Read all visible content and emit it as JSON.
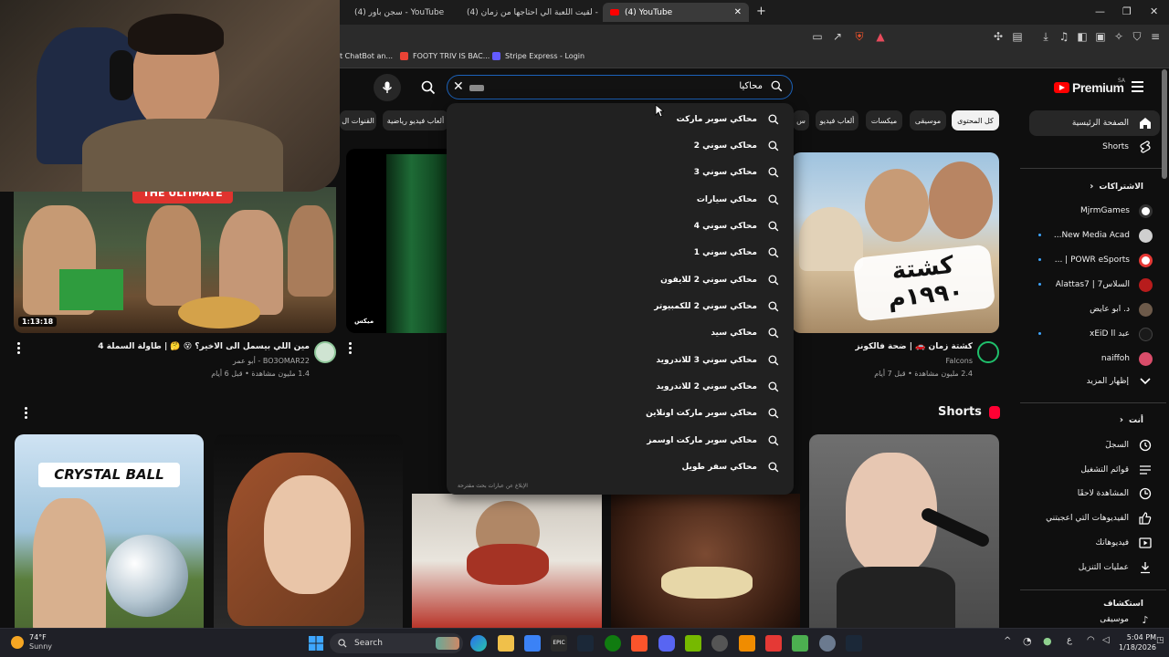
{
  "browser": {
    "tabs": [
      {
        "label": "(4) سجن باور - YouTube",
        "active": false
      },
      {
        "label": "(4) لقيت اللعبة الي احتاجها من زمان - Yo",
        "active": false
      },
      {
        "label": "(4) YouTube",
        "active": true
      }
    ],
    "new_tab_label": "+",
    "bookmarks": [
      {
        "label": "t ChatBot an...",
        "color": "#10a37f"
      },
      {
        "label": "FOOTY TRIV IS BAC...",
        "color": "#ea4335"
      },
      {
        "label": "Stripe Express - Login",
        "color": "#635bff"
      }
    ]
  },
  "youtube": {
    "logo_text": "Premium",
    "region": "SA",
    "search": {
      "value": "محاكيا",
      "clear_icon": "close-icon",
      "search_icon": "search-icon",
      "mic_icon": "mic-icon"
    },
    "chips": [
      {
        "label": "كل المحتوى",
        "active": true
      },
      {
        "label": "موسيقى",
        "active": false
      },
      {
        "label": "ميكسات",
        "active": false
      },
      {
        "label": "ألعاب فيديو",
        "active": false
      },
      {
        "label": "س",
        "active": false
      },
      {
        "label": "ألعاب فيديو رياضية",
        "active": false
      },
      {
        "label": "القنوات ال",
        "active": false
      }
    ],
    "sidebar": {
      "main": [
        {
          "label": "الصفحة الرئيسية",
          "icon": "home-icon",
          "active": true
        },
        {
          "label": "Shorts",
          "icon": "shorts-icon",
          "active": false
        }
      ],
      "subscriptions_title": "الاشتراكات",
      "subscriptions": [
        {
          "label": "MjrmGames",
          "color": "#ffffff",
          "dot": false
        },
        {
          "label": "New Media Acad...",
          "color": "#cfcfcf",
          "dot": true
        },
        {
          "label": "POWR eSports | ...",
          "color": "#e53935",
          "dot": true
        },
        {
          "label": "السلاس7 | Alattas7",
          "color": "#b71c1c",
          "dot": true
        },
        {
          "label": "د. أبو عايض",
          "color": "#6d5a4a",
          "dot": false
        },
        {
          "label": "عبد xEiD ll",
          "color": "#1a1a1a",
          "dot": true
        },
        {
          "label": "naiffoh",
          "color": "#d94d6a",
          "dot": false
        }
      ],
      "show_more": "إظهار المزيد",
      "you_title": "أنت",
      "you": [
        {
          "label": "السجلّ",
          "icon": "history-icon"
        },
        {
          "label": "قوائم التشغيل",
          "icon": "playlists-icon"
        },
        {
          "label": "المشاهدة لاحقًا",
          "icon": "watch-later-icon"
        },
        {
          "label": "الفيديوهات التي أعجبتني",
          "icon": "like-icon"
        },
        {
          "label": "فيديوهاتك",
          "icon": "your-videos-icon"
        },
        {
          "label": "عمليات التنزيل",
          "icon": "download-icon"
        }
      ],
      "explore_title": "استكشاف",
      "explore_first": "موسيقى"
    },
    "videos": [
      {
        "title": "كشتة زمان 🚗 | ضحة فالكونز",
        "channel": "Falcons",
        "meta": "2.4 مليون مشاهدة • قبل 7 أيام",
        "thumb_caption": "كشتة ١٩٩٠م"
      },
      {
        "title": "مين اللي بيسمل الى الاخير؟ 😵 🤔 | طاولة السملة 4",
        "channel": "BO3OMAR22 - أبو عمر",
        "meta": "1.4 مليون مشاهدة • قبل 6 أيام",
        "duration": "1:13:18",
        "thumb_caption": "THE ULTIMATE"
      },
      {
        "duration": "ميكس"
      }
    ],
    "shorts_title": "Shorts",
    "shorts": [
      {
        "caption": "CRYSTAL BALL"
      }
    ],
    "suggestions": [
      "محاكي سوبر ماركت",
      "محاكي سوني 2",
      "محاكي سوني 3",
      "محاكي سيارات",
      "محاكي سوني 4",
      "محاكي سوني 1",
      "محاكي سوني 2 للايفون",
      "محاكي سوني 2 للكمبيوتر",
      "محاكي سيد",
      "محاكي سوني 3 للاندرويد",
      "محاكي سوني 2 للاندرويد",
      "محاكي سوبر ماركت اونلاين",
      "محاكي سوبر ماركت اوسمز",
      "محاكي سفر طويل"
    ],
    "report_suggestions": "الإبلاغ عن عبارات بحث مقترحة"
  },
  "taskbar": {
    "weather_temp": "74°F",
    "weather_desc": "Sunny",
    "search_label": "Search",
    "time": "5:04 PM",
    "date": "1/18/2026"
  },
  "colors": {
    "accent": "#3ea6ff",
    "brand_red": "#ff0000",
    "background": "#0f0f0f"
  }
}
